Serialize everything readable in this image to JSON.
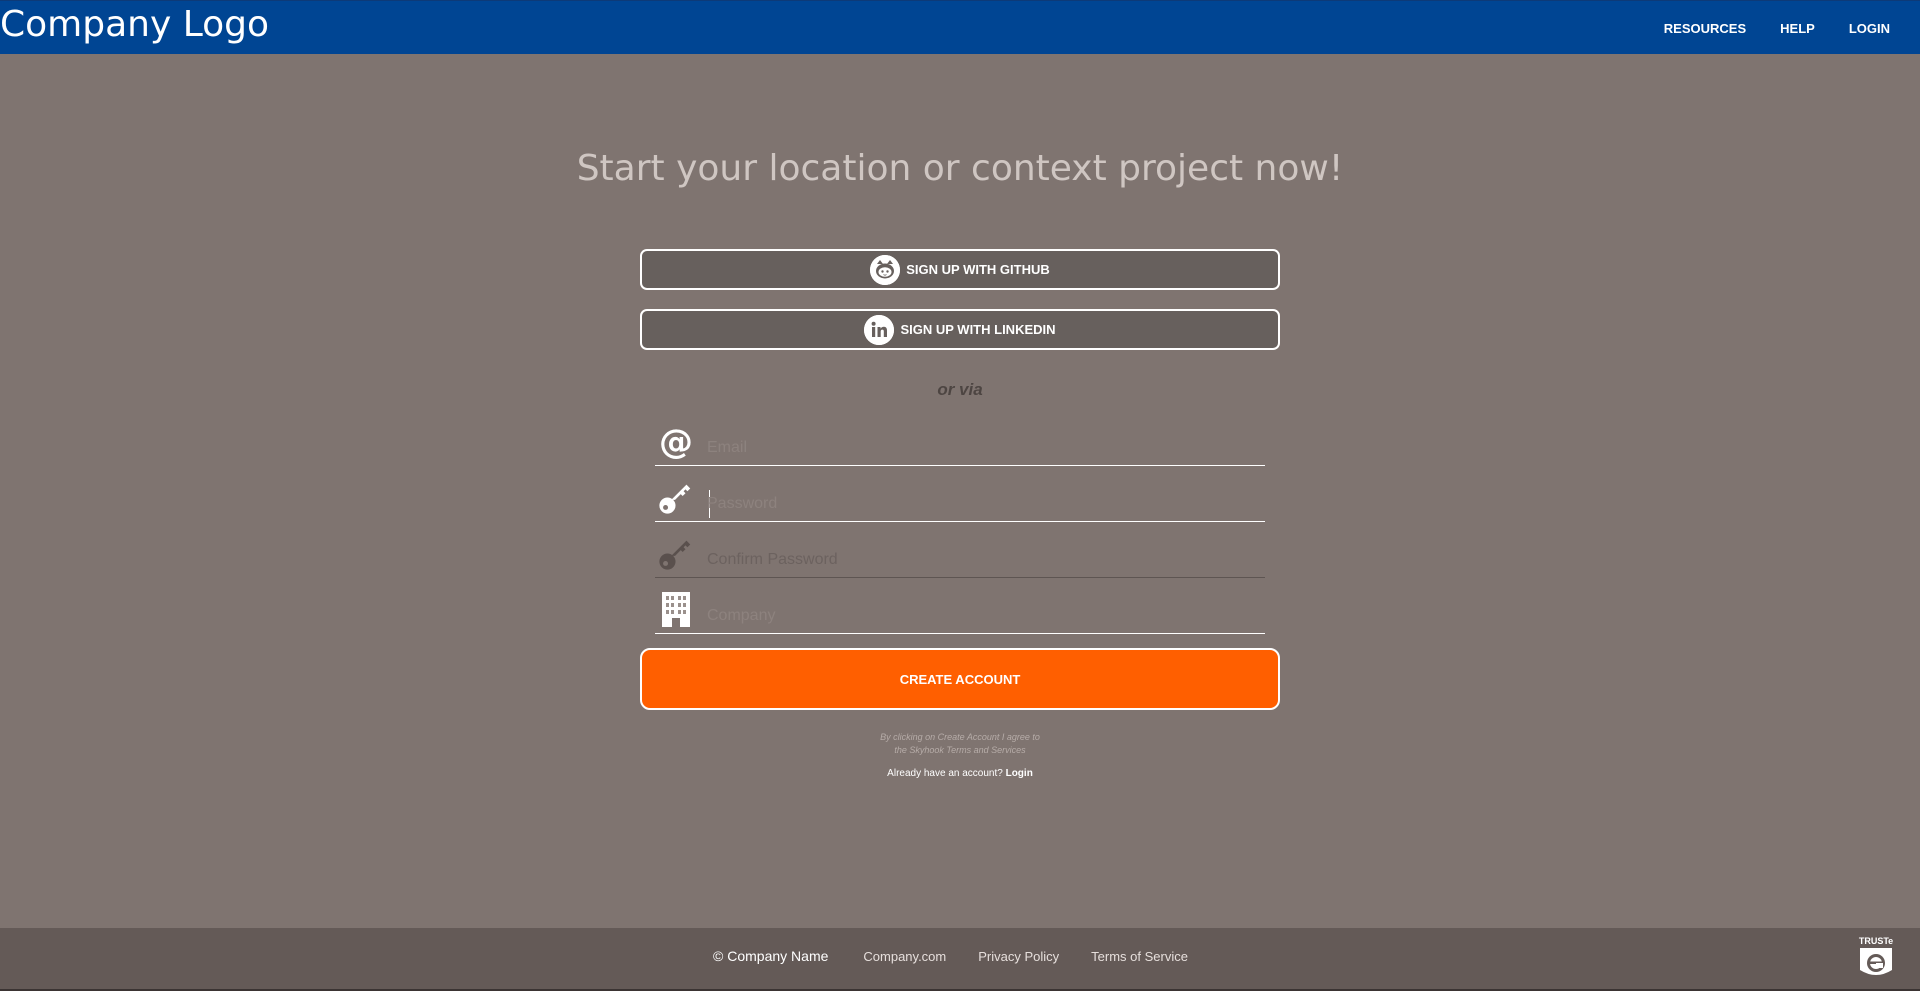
{
  "header": {
    "logo": "Company Logo",
    "nav": [
      "RESOURCES",
      "HELP",
      "LOGIN"
    ]
  },
  "main": {
    "headline": "Start your location or context project now!",
    "github_label": "SIGN UP WITH GITHUB",
    "linkedin_label": "SIGN UP WITH LINKEDIN",
    "or_via": "or via",
    "fields": {
      "email_placeholder": "Email",
      "password_placeholder": "Password",
      "confirm_placeholder": "Confirm Password",
      "company_placeholder": "Company"
    },
    "create_label": "CREATE ACCOUNT",
    "terms_line1": "By clicking on Create Account I agree to",
    "terms_line2": "the Skyhook Terms and Services",
    "already_text": "Already have an account?",
    "login_link": "Login"
  },
  "footer": {
    "copyright": "© Company Name",
    "links": [
      "Company.com",
      "Privacy Policy",
      "Terms of Service"
    ],
    "badge": "TRUSTe"
  },
  "colors": {
    "topbar": "#004593",
    "background": "#7f7470",
    "cta": "#ff5f00",
    "footer": "#645a57"
  },
  "icons": [
    "github-icon",
    "linkedin-icon",
    "at-icon",
    "key-icon",
    "building-icon",
    "truste-icon"
  ]
}
